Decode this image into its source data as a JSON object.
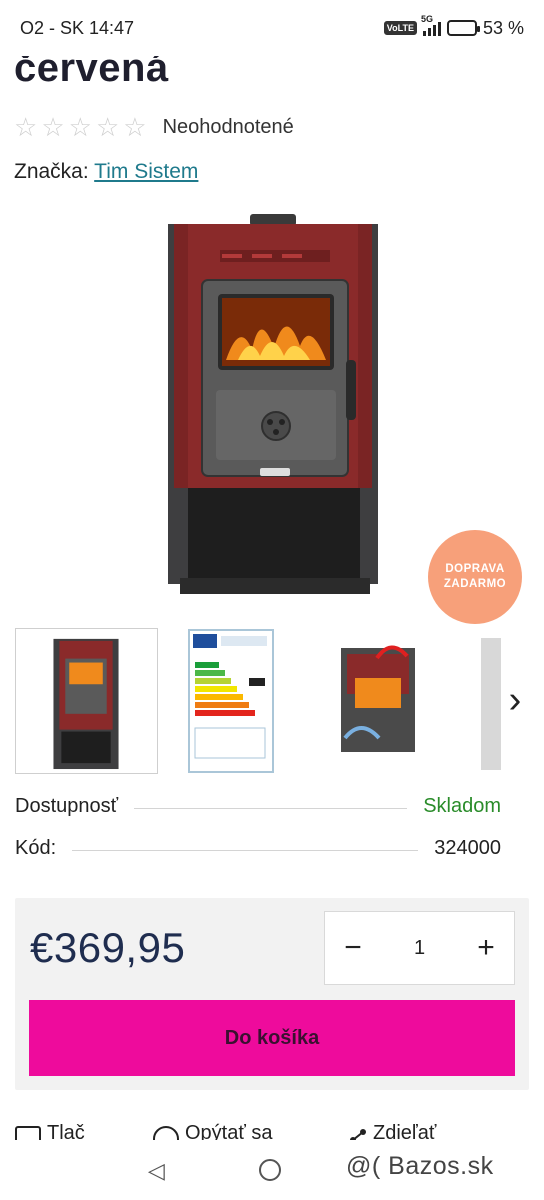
{
  "status_bar": {
    "carrier_time": "O2 - SK 14:47",
    "volte": "VoLTE",
    "network": "5G",
    "battery": "53 %",
    "battery_level": 0.53
  },
  "product": {
    "title": "červená",
    "rating_label": "Neohodnotené",
    "rating_stars_filled": 0,
    "rating_stars_total": 5,
    "brand_label": "Značka:",
    "brand_name": "Tim Sistem",
    "badge_line1": "DOPRAVA",
    "badge_line2": "ZADARMO",
    "availability_label": "Dostupnosť",
    "availability_value": "Skladom",
    "code_label": "Kód:",
    "code_value": "324000",
    "price": "€369,95",
    "quantity": "1",
    "qty_minus": "−",
    "qty_plus": "+",
    "add_to_cart": "Do košíka"
  },
  "thumbnails": [
    "stove-front-photo",
    "energy-label",
    "stove-cutaway",
    "stove-side"
  ],
  "actions": {
    "print": "Tlač",
    "ask": "Opýtať sa",
    "share": "Zdieľať"
  },
  "nav": {
    "watermark": "@( Bazos.sk"
  },
  "colors": {
    "accent_pink": "#ee0b9c",
    "badge_orange": "#f7a07a",
    "link_teal": "#1f7a8c",
    "in_stock_green": "#2a8c2a",
    "price_navy": "#1f2d4f"
  }
}
